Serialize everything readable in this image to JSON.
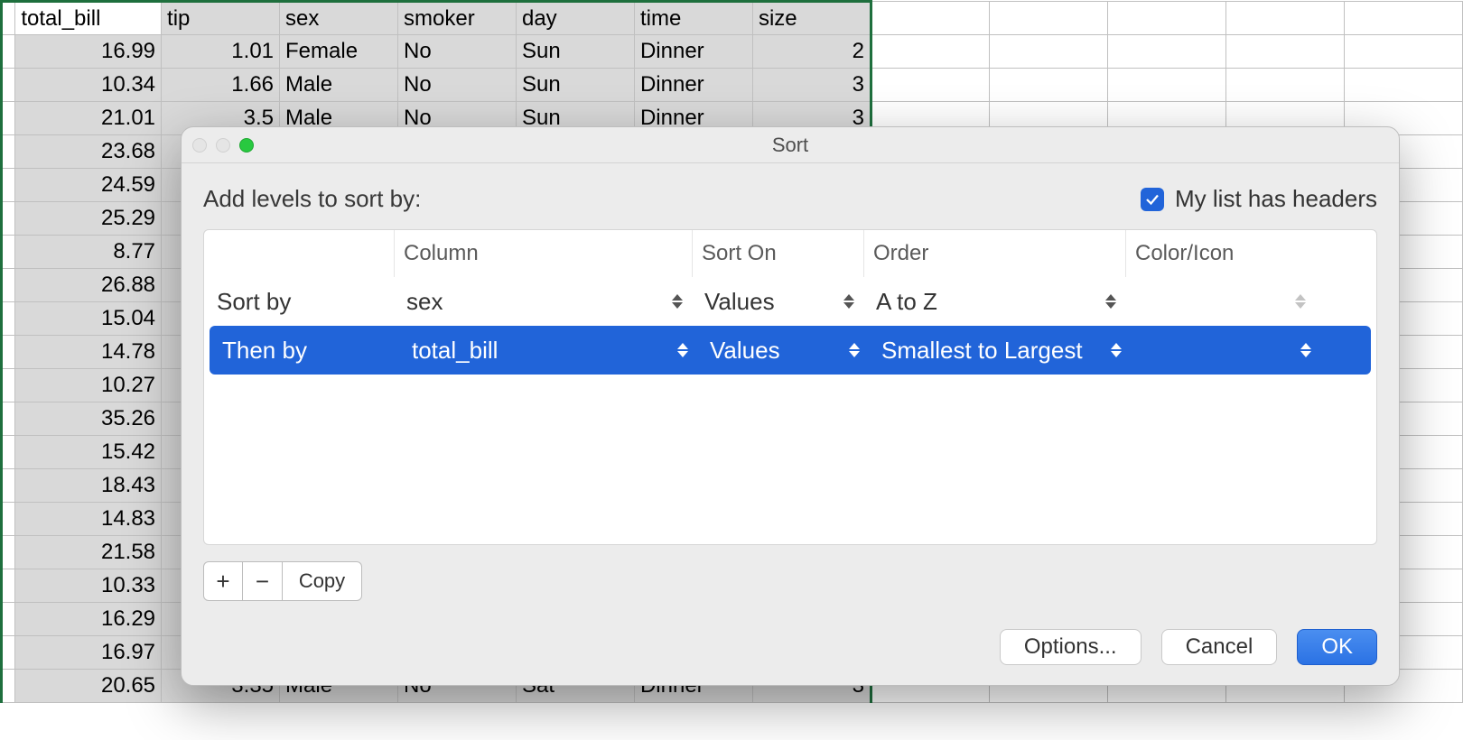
{
  "spreadsheet": {
    "headers": [
      "total_bill",
      "tip",
      "sex",
      "smoker",
      "day",
      "time",
      "size"
    ],
    "rows": [
      [
        "16.99",
        "1.01",
        "Female",
        "No",
        "Sun",
        "Dinner",
        "2"
      ],
      [
        "10.34",
        "1.66",
        "Male",
        "No",
        "Sun",
        "Dinner",
        "3"
      ],
      [
        "21.01",
        "3.5",
        "Male",
        "No",
        "Sun",
        "Dinner",
        "3"
      ],
      [
        "23.68",
        "",
        "",
        "",
        "",
        "",
        ""
      ],
      [
        "24.59",
        "",
        "",
        "",
        "",
        "",
        ""
      ],
      [
        "25.29",
        "",
        "",
        "",
        "",
        "",
        ""
      ],
      [
        "8.77",
        "",
        "",
        "",
        "",
        "",
        ""
      ],
      [
        "26.88",
        "",
        "",
        "",
        "",
        "",
        ""
      ],
      [
        "15.04",
        "",
        "",
        "",
        "",
        "",
        ""
      ],
      [
        "14.78",
        "",
        "",
        "",
        "",
        "",
        ""
      ],
      [
        "10.27",
        "",
        "",
        "",
        "",
        "",
        ""
      ],
      [
        "35.26",
        "",
        "",
        "",
        "",
        "",
        ""
      ],
      [
        "15.42",
        "",
        "",
        "",
        "",
        "",
        ""
      ],
      [
        "18.43",
        "",
        "",
        "",
        "",
        "",
        ""
      ],
      [
        "14.83",
        "",
        "",
        "",
        "",
        "",
        ""
      ],
      [
        "21.58",
        "",
        "",
        "",
        "",
        "",
        ""
      ],
      [
        "10.33",
        "",
        "",
        "",
        "",
        "",
        ""
      ],
      [
        "16.29",
        "",
        "",
        "",
        "",
        "",
        ""
      ],
      [
        "16.97",
        "",
        "",
        "",
        "",
        "",
        ""
      ],
      [
        "20.65",
        "3.35",
        "Male",
        "No",
        "Sat",
        "Dinner",
        "3"
      ]
    ]
  },
  "dialog": {
    "title": "Sort",
    "prompt": "Add levels to sort by:",
    "headers_checkbox_label": "My list has headers",
    "headers_checked": true,
    "columns": {
      "level": "",
      "column": "Column",
      "sort_on": "Sort On",
      "order": "Order",
      "color": "Color/Icon"
    },
    "levels": [
      {
        "label": "Sort by",
        "column": "sex",
        "sort_on": "Values",
        "order": "A to Z",
        "selected": false
      },
      {
        "label": "Then by",
        "column": "total_bill",
        "sort_on": "Values",
        "order": "Smallest to Largest",
        "selected": true
      }
    ],
    "level_buttons": {
      "add": "+",
      "remove": "−",
      "copy": "Copy"
    },
    "footer": {
      "options": "Options...",
      "cancel": "Cancel",
      "ok": "OK"
    }
  }
}
